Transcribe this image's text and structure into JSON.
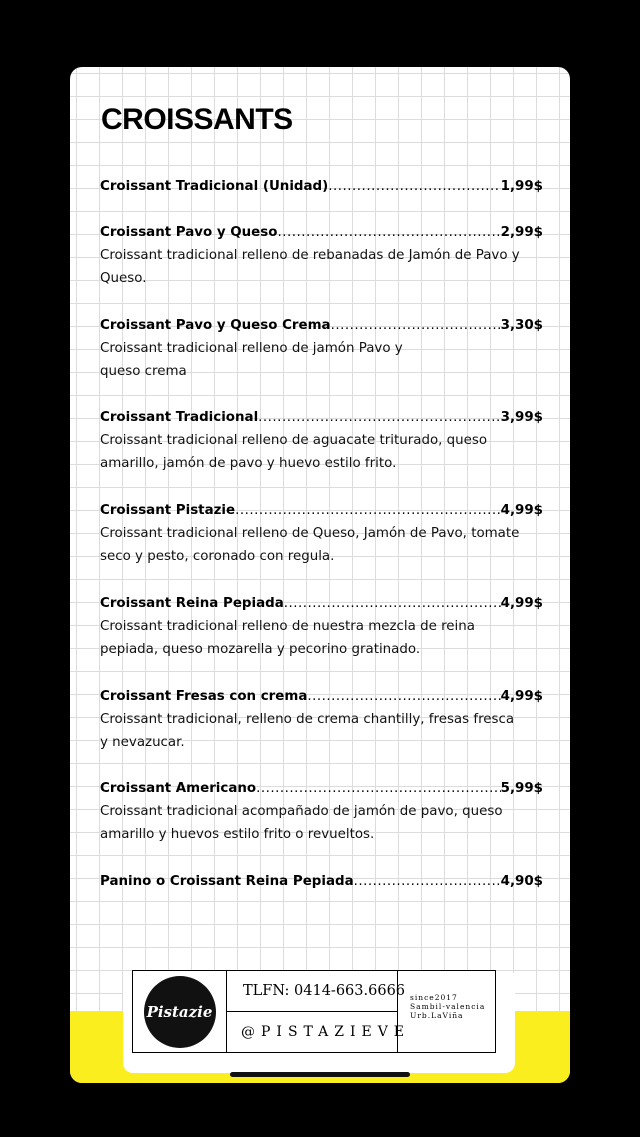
{
  "menu": {
    "title": "CROISSANTS",
    "items": [
      {
        "name": "Croissant Tradicional (Unidad) ",
        "price": "1,99$",
        "desc": ""
      },
      {
        "name": "Croissant Pavo y Queso",
        "price": "2,99$",
        "desc": "Croissant tradicional relleno de rebanadas de Jamón de Pavo y Queso."
      },
      {
        "name": "Croissant Pavo y Queso Crema",
        "price": " 3,30$",
        "desc": "Croissant tradicional relleno de jamón Pavo  y queso crema"
      },
      {
        "name": "Croissant Tradicional",
        "price": "3,99$",
        "desc": "Croissant tradicional relleno de aguacate triturado, queso amarillo, jamón de pavo y huevo estilo frito."
      },
      {
        "name": "Croissant Pistazie",
        "price": "4,99$",
        "desc": "Croissant tradicional relleno de Queso, Jamón de Pavo, tomate seco y pesto, coronado con regula."
      },
      {
        "name": "Croissant Reina Pepiada",
        "price": "4,99$",
        "desc": "Croissant tradicional relleno de nuestra mezcla de reina pepiada, queso mozarella y pecorino gratinado."
      },
      {
        "name": "Croissant Fresas con crema",
        "price": "4,99$",
        "desc": "Croissant tradicional, relleno de crema chantilly, fresas fresca y nevazucar."
      },
      {
        "name": "Croissant Americano ",
        "price": "5,99$",
        "desc": "Croissant tradicional acompañado de jamón de pavo, queso amarillo y huevos estilo frito o revueltos."
      },
      {
        "name": "Panino o Croissant Reina Pepiada",
        "price": " 4,90$",
        "desc": ""
      }
    ]
  },
  "footer": {
    "logo": "Pistazie",
    "phone": "TLFN: 0414-663.6666",
    "handle": "@PISTAZIEVE",
    "since": "since2017",
    "location1": "Sambil-valencia",
    "location2": "Urb.LaViña"
  },
  "colors": {
    "accent": "#fbee1f",
    "background": "#000000",
    "card": "#ffffff"
  }
}
